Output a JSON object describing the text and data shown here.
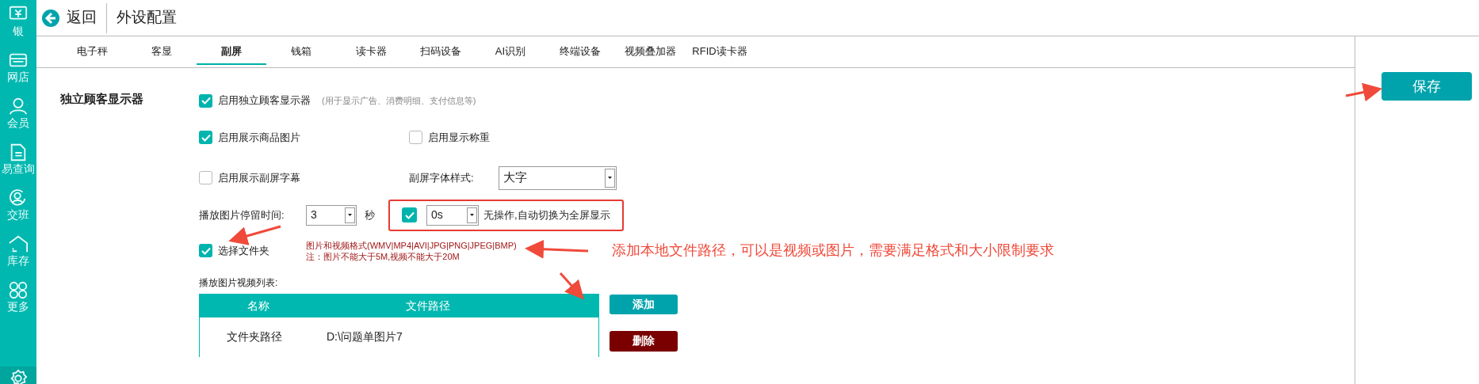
{
  "sidebar": {
    "items": [
      {
        "label": "银",
        "kind": "money"
      },
      {
        "label": "网店",
        "kind": "shop"
      },
      {
        "label": "会员",
        "kind": "person"
      },
      {
        "label": "易查询",
        "kind": "doc"
      },
      {
        "label": "交班",
        "kind": "shift"
      },
      {
        "label": "库存",
        "kind": "house"
      },
      {
        "label": "更多",
        "kind": "more"
      }
    ]
  },
  "header": {
    "back": "返回",
    "title": "外设配置"
  },
  "tabs": [
    {
      "label": "电子秤",
      "selected": false
    },
    {
      "label": "客显",
      "selected": false
    },
    {
      "label": "副屏",
      "selected": true
    },
    {
      "label": "钱箱",
      "selected": false
    },
    {
      "label": "读卡器",
      "selected": false
    },
    {
      "label": "扫码设备",
      "selected": false
    },
    {
      "label": "AI识别",
      "selected": false
    },
    {
      "label": "终端设备",
      "selected": false
    },
    {
      "label": "视频叠加器",
      "selected": false
    },
    {
      "label": "RFID读卡器",
      "selected": false
    }
  ],
  "section_title": "独立顾客显示器",
  "enable_display": {
    "label": "启用独立顾客显示器",
    "checked": true,
    "hint": "(用于显示广告、消费明细、支付信息等)"
  },
  "show_goods_image": {
    "label": "启用展示商品图片",
    "checked": true
  },
  "show_weight": {
    "label": "启用显示称重",
    "checked": false
  },
  "show_subtitle": {
    "label": "启用展示副屏字幕",
    "checked": false
  },
  "font_style": {
    "label": "副屏字体样式:",
    "value": "大字"
  },
  "dwell": {
    "label": "播放图片停留时间:",
    "value": "3",
    "unit": "秒"
  },
  "idle_switch": {
    "checked": true,
    "value": "0s",
    "label": "无操作,自动切换为全屏显示"
  },
  "select_folder": {
    "label": "选择文件夹",
    "checked": true
  },
  "format_note": [
    "图片和视频格式(WMV|MP4|AVI|JPG|PNG|JPEG|BMP)",
    "注：图片不能大于5M,视频不能大于20M"
  ],
  "annotation": "添加本地文件路径，可以是视频或图片，需要满足格式和大小限制要求",
  "list_label": "播放图片视频列表:",
  "table": {
    "columns": [
      "名称",
      "文件路径"
    ],
    "rows": [
      [
        "文件夹路径",
        "D:\\问题单图片7"
      ]
    ]
  },
  "buttons": {
    "add": "添加",
    "delete": "删除",
    "save": "保存"
  }
}
